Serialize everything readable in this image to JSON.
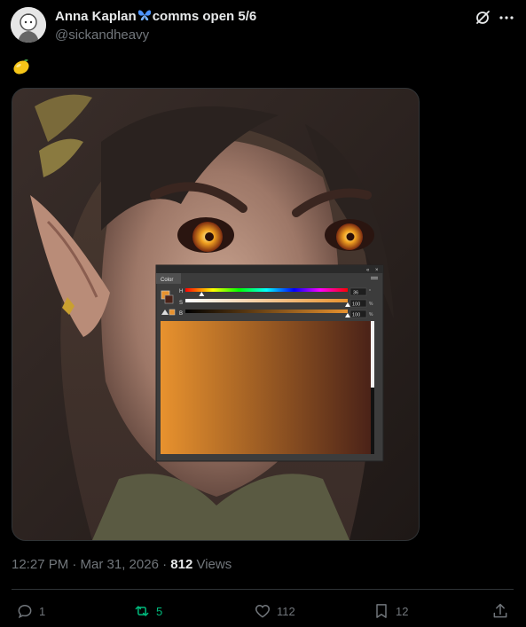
{
  "author": {
    "name": "Anna Kaplan",
    "name_suffix": "comms open 5/6",
    "handle": "@sickandheavy"
  },
  "post": {
    "emoji_icon": "lemon-emoji",
    "timestamp": "12:27 PM · Mar 31, 2026 · ",
    "views_count": "812",
    "views_label": " Views"
  },
  "media": {
    "color_panel": {
      "title": "Color",
      "h_label": "H",
      "s_label": "S",
      "b_label": "B",
      "h_value": "36",
      "s_value": "100",
      "b_value": "100",
      "h_unit": "°",
      "s_unit": "%",
      "b_unit": "%",
      "h_level": 0.1,
      "s_level": 1.0,
      "b_level": 1.0,
      "swatch_color": "#e8922e"
    }
  },
  "actions": {
    "replies": "1",
    "reposts": "5",
    "likes": "112",
    "bookmarks": "12"
  },
  "colors": {
    "repost_active": "#00ba7c",
    "muted": "#71767b",
    "text": "#e7e9ea"
  }
}
